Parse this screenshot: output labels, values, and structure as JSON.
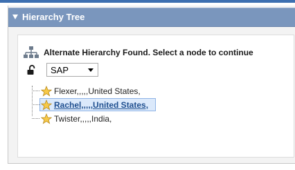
{
  "panel": {
    "title": "Hierarchy Tree"
  },
  "message": "Alternate Hierarchy Found. Select a node to continue",
  "hierarchy_select": {
    "value": "SAP"
  },
  "tree": {
    "nodes": [
      {
        "label": "Flexer,,,,,United States,",
        "selected": false
      },
      {
        "label": "Rachel,,,,,United States,",
        "selected": true
      },
      {
        "label": "Twister,,,,,India,",
        "selected": false
      }
    ]
  },
  "colors": {
    "accent": "#3d6fb0",
    "header_bg": "#7a96bd",
    "selected_bg": "#dbe9fb",
    "selected_text": "#1f4f8f",
    "star": "#f7c948"
  },
  "icons": {
    "header_toggle": "triangle-down-icon",
    "hierarchy": "hierarchy-icon",
    "lock": "unlock-icon",
    "node": "star-icon"
  }
}
